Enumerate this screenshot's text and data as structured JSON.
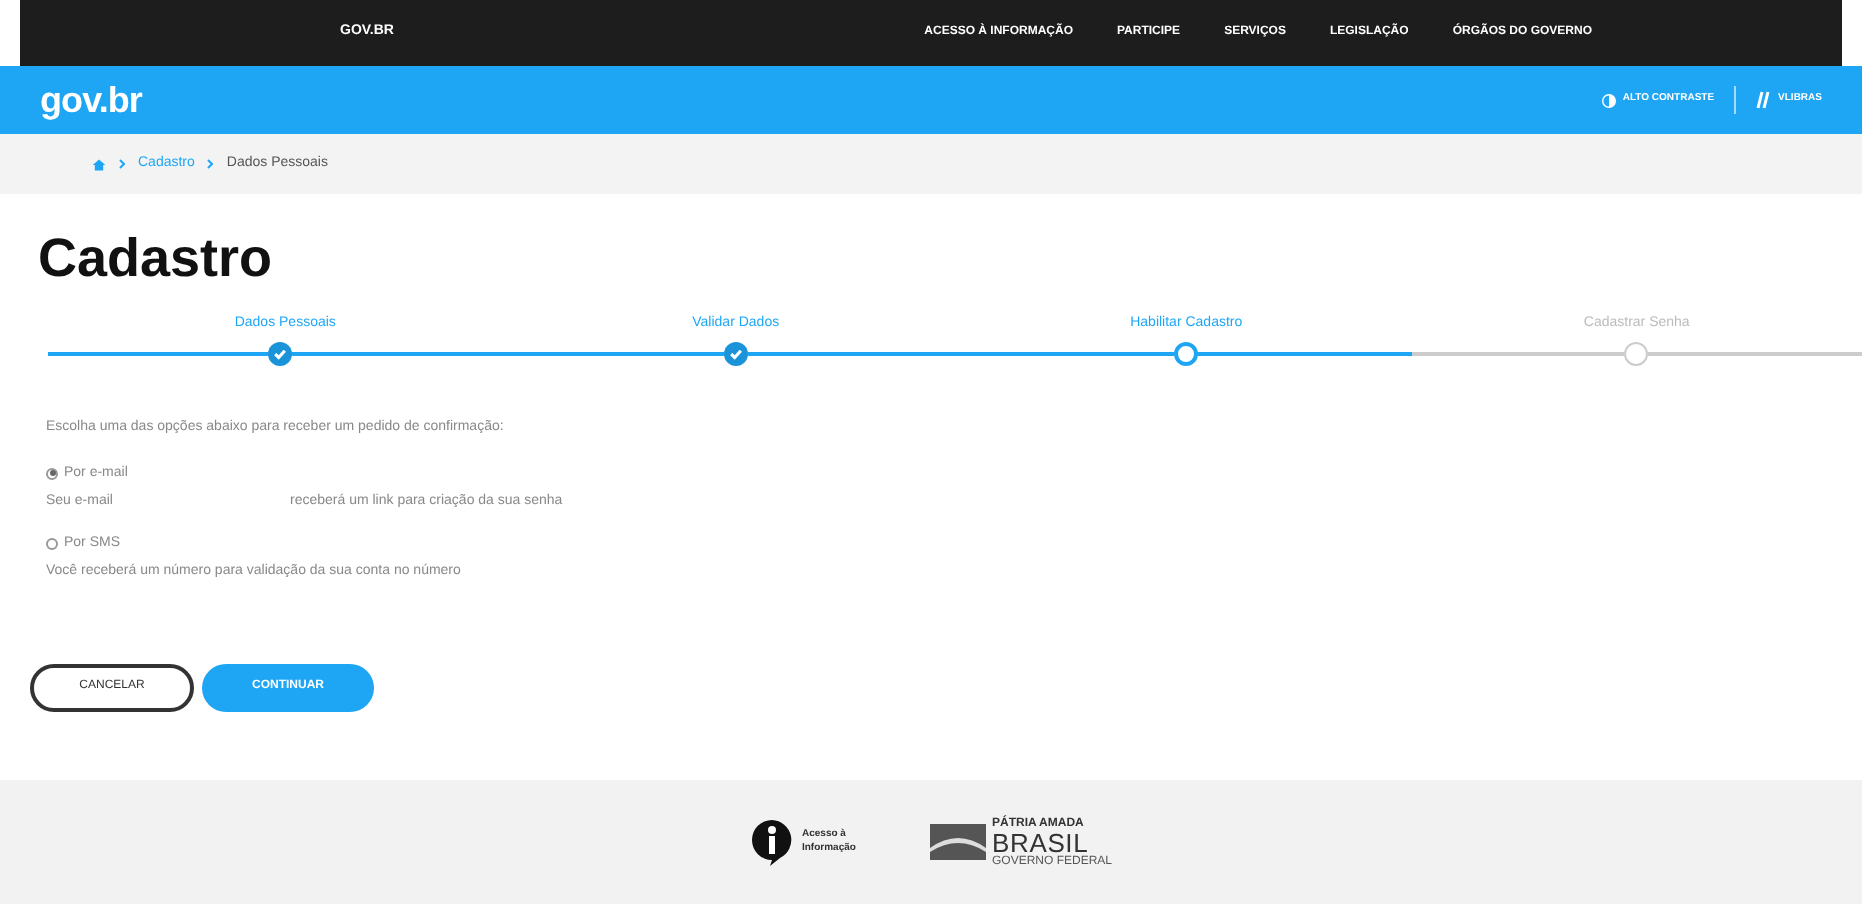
{
  "top_bar": {
    "brand": "GOV.BR",
    "links": [
      "ACESSO À INFORMAÇÃO",
      "PARTICIPE",
      "SERVIÇOS",
      "LEGISLAÇÃO",
      "ÓRGÃOS DO GOVERNO"
    ]
  },
  "header": {
    "logo": "gov.br",
    "contrast": "ALTO CONTRASTE",
    "vlibras": "VLIBRAS"
  },
  "breadcrumb": [
    "Cadastro",
    "Dados Pessoais"
  ],
  "title": "Cadastro",
  "steps": [
    {
      "label": "Dados Pessoais",
      "done": true,
      "current": false
    },
    {
      "label": "Validar Dados",
      "done": true,
      "current": false
    },
    {
      "label": "Habilitar Cadastro",
      "done": false,
      "current": true
    },
    {
      "label": "Cadastrar Senha",
      "done": false,
      "current": false
    }
  ],
  "prompt": "Escolha uma das opções abaixo para receber um pedido de confirmação:",
  "options": [
    {
      "label": "Por e-mail",
      "selected": true,
      "note_start": "Seu e-mail",
      "note_end": "receberá um link para criação da sua senha"
    },
    {
      "label": "Por SMS",
      "selected": false,
      "note_start": "Você receberá um número para validação da sua conta no número"
    }
  ],
  "buttons": [
    {
      "label": "CANCELAR",
      "kind": "secondary"
    },
    {
      "label": "CONTINUAR",
      "kind": "primary"
    }
  ],
  "footer": {
    "access": "Acesso à Informação",
    "motto": "PÁTRIA AMADA",
    "country": "BRASIL",
    "gov": "GOVERNO FEDERAL"
  }
}
